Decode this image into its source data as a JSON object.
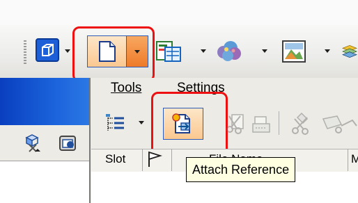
{
  "menu": {
    "tools": "Tools",
    "settings": "Settings"
  },
  "columns": {
    "slot": "Slot",
    "file_name": "File Name",
    "more": "M"
  },
  "tooltip": "Attach Reference",
  "icons": {
    "toolbar": [
      "view-cube-icon",
      "new-document-icon",
      "references-icon",
      "raster-cloud-icon",
      "image-manager-icon",
      "layers-icon"
    ],
    "dialog_toolbar": [
      "hierarchy-list-icon",
      "attach-reference-icon",
      "detach-reference-icon",
      "reload-icon",
      "exchange-icon",
      "measure-icon"
    ]
  },
  "colors": {
    "highlight": "#ee1010",
    "blue_header": "#1b64dc",
    "tooltip_bg": "#ffffe1"
  }
}
